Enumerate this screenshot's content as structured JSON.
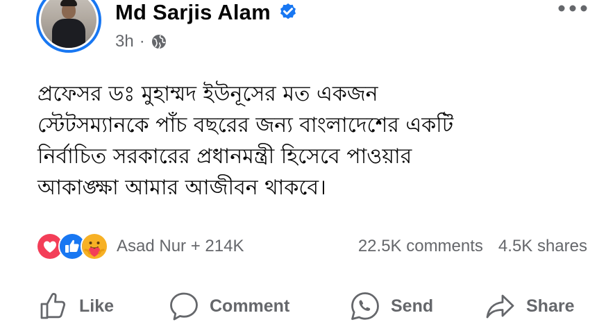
{
  "post": {
    "author_name": "Md Sarjis Alam",
    "timestamp": "3h",
    "separator": "·",
    "text_lines": [
      "প্রফেসর ডঃ মুহাম্মদ ইউনূসের মত একজন",
      "স্টেটসম্যানকে পাঁচ বছরের জন্য বাংলাদেশের একটি",
      "নির্বাচিত সরকারের প্রধানমন্ত্রী হিসেবে পাওয়ার",
      "আকাঙ্ক্ষা আমার আজীবন থাকবে।"
    ],
    "icons": {
      "verified": "verified-badge-icon",
      "audience": "globe-icon",
      "menu": "more-options-icon"
    },
    "colors": {
      "accent": "#1877f2",
      "secondary_text": "#65676b",
      "love": "#f33e58",
      "care": "#f7b125"
    }
  },
  "engagement": {
    "reactions": [
      "love",
      "like",
      "care"
    ],
    "reactors_label": "Asad Nur + 214K",
    "comments_label": "22.5K comments",
    "shares_label": "4.5K shares"
  },
  "actions": {
    "like_label": "Like",
    "comment_label": "Comment",
    "send_label": "Send",
    "share_label": "Share"
  }
}
